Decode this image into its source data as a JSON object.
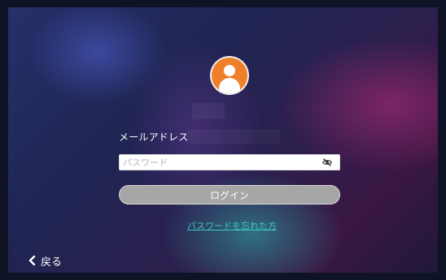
{
  "login": {
    "email_label": "メールアドレス",
    "email_value": "",
    "password_placeholder": "パスワード",
    "login_button": "ログイン",
    "forgot_password": "パスワードを忘れた方",
    "back": "戻る"
  },
  "colors": {
    "avatar": "#f07f2a",
    "link": "#3ec9c0",
    "button": "#a6a6a6"
  },
  "icons": {
    "avatar": "user-avatar-icon",
    "password_toggle": "eye-slash-icon",
    "back": "chevron-left-icon"
  }
}
